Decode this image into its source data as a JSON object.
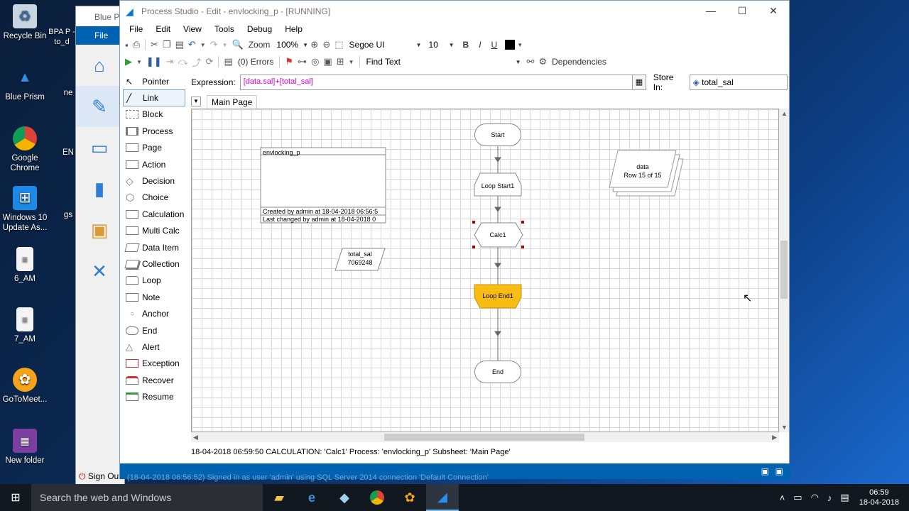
{
  "desktop": {
    "icons": [
      {
        "label": "Recycle Bin",
        "icon": "recycle-bin-icon"
      },
      {
        "label": "Blue Prism",
        "icon": "blue-prism-icon"
      },
      {
        "label": "Google Chrome",
        "icon": "chrome-icon"
      },
      {
        "label": "Windows 10 Update As...",
        "icon": "windows-update-icon"
      },
      {
        "label": "6_AM",
        "icon": "document-icon"
      },
      {
        "label": "7_AM",
        "icon": "document-icon"
      },
      {
        "label": "GoToMeet...",
        "icon": "gotomeeting-icon"
      },
      {
        "label": "New folder",
        "icon": "winrar-icon"
      }
    ],
    "partial_icons": [
      "BPA P - to_d",
      "ne",
      "EN",
      "gs"
    ]
  },
  "bp_window": {
    "title": "Blue Pr",
    "file_tab": "File",
    "sign_out": "Sign Out"
  },
  "window": {
    "title": "Process Studio - Edit - envlocking_p - [RUNNING]",
    "accent": "#0063b1"
  },
  "menu": [
    "File",
    "Edit",
    "View",
    "Tools",
    "Debug",
    "Help"
  ],
  "toolbar": {
    "zoom_label": "Zoom",
    "zoom_value": "100%",
    "font_name": "Segoe UI",
    "font_size": "10",
    "bold": "B",
    "italic": "I",
    "underline": "U",
    "errors": "(0) Errors",
    "find_text": "Find Text",
    "dependencies": "Dependencies"
  },
  "palette": [
    "Pointer",
    "Link",
    "Block",
    "Process",
    "Page",
    "Action",
    "Decision",
    "Choice",
    "Calculation",
    "Multi Calc",
    "Data Item",
    "Collection",
    "Loop",
    "Note",
    "Anchor",
    "End",
    "Alert",
    "Exception",
    "Recover",
    "Resume"
  ],
  "selected_tool": "Link",
  "expression": {
    "label": "Expression:",
    "value": "[data.sal]+[total_sal]",
    "store_label": "Store In:",
    "store_value": "total_sal"
  },
  "page_tab": "Main Page",
  "diagram": {
    "info_box": {
      "title": "envlocking_p",
      "created": "Created by admin at 18-04-2018 06:56:5",
      "changed": "Last changed by admin at 18-04-2018 0"
    },
    "data_item": {
      "name": "total_sal",
      "value": "7069248"
    },
    "collection": {
      "name": "data",
      "value": "Row 15 of 15"
    },
    "stages": {
      "start": "Start",
      "loop_start": "Loop Start1",
      "calc": "Calc1",
      "loop_end": "Loop End1",
      "end": "End"
    },
    "loop_end_color": "#f8bc14"
  },
  "status": "18-04-2018 06:59:50 CALCULATION: 'Calc1' Process: 'envlocking_p' Subsheet: 'Main Page'",
  "bottom_strip": "(18-04-2018 06:56:52) Signed in as user 'admin' using SQL Server 2014 connection 'Default Connection'",
  "taskbar": {
    "search_placeholder": "Search the web and Windows",
    "time": "06:59",
    "date": "18-04-2018"
  }
}
